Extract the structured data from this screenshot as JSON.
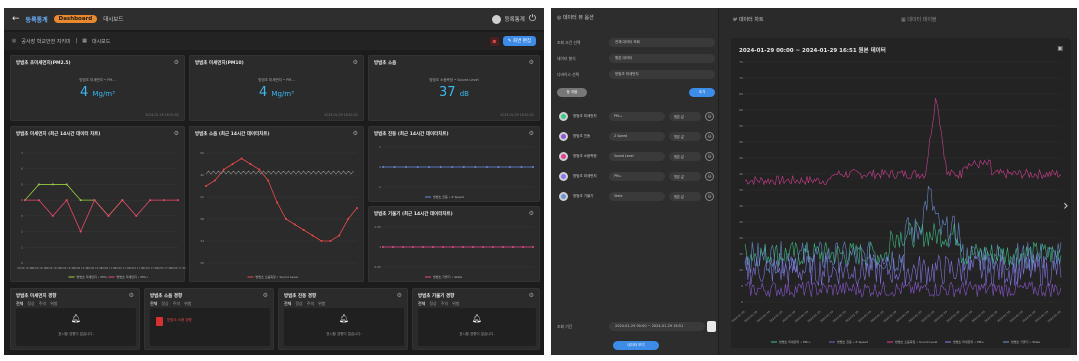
{
  "left": {
    "topbar": {
      "brand": "등록통계",
      "dashboard_pill": "Dashboard",
      "page": "대시보드",
      "user": "등록통계"
    },
    "crumb": {
      "path": "공사장 학교안전 지키미",
      "separator": "|",
      "page": "대시보드",
      "edit_button": "화면 편집"
    },
    "cards": {
      "pm10": {
        "title": "방범초 초미세먼지(PM2.5)",
        "sub": "방범초 미세먼지 • PM...",
        "value": "4",
        "unit": "Mg/m³",
        "stamp": "2024.01.29 16:51:52"
      },
      "pm25": {
        "title": "방범초 미세먼지(PM10)",
        "sub": "방범초 미세먼지 • PM...",
        "value": "4",
        "unit": "Mg/m³",
        "stamp": "2024.01.29 16:51:52"
      },
      "sound": {
        "title": "방범초 소음",
        "sub": "방범초 소음측정 • Sound Level",
        "value": "37",
        "unit": "dB",
        "stamp": "2024.01.29 16:51:52"
      },
      "dust_chart": {
        "title": "방범초 미세먼지 (최근 14시간 데이터 차트)",
        "legend1": "방범초 미세먼지 • PM₁₀",
        "legend2": "방범초 미세먼지 • PM₂.₅"
      },
      "sound_chart": {
        "title": "방범초 소음 (최근 14시간 데이터차트)",
        "legend1": "방범초 소음측정 • Sound Level"
      },
      "vib_chart": {
        "title": "방범초 진동 (최근 14시간 데이터차트)",
        "legend1": "방범초 진동 • Z Speed"
      },
      "tilt_chart": {
        "title": "방범초 기울기 (최근 14시간 데이터차트)",
        "legend1": "방범초 기울기 • State"
      },
      "alerts": [
        {
          "title": "방범초 미세먼지 경향",
          "tabs": [
            "전체",
            "정상",
            "주의",
            "위험"
          ],
          "msg": "표시할 경향이 없습니다."
        },
        {
          "title": "방범초 소음 경향",
          "tabs": [
            "전체",
            "정상",
            "주의",
            "위험"
          ],
          "item": "방범초 소음 경향",
          "msg": ""
        },
        {
          "title": "방범초 진동 경향",
          "tabs": [
            "전체",
            "정상",
            "주의",
            "위험"
          ],
          "msg": "표시할 경향이 없습니다."
        },
        {
          "title": "방범초 기울기 경향",
          "tabs": [
            "전체",
            "정상",
            "주의",
            "위험"
          ],
          "msg": "표시할 경향이 없습니다."
        }
      ]
    }
  },
  "right": {
    "panel": {
      "heading": "데이터 뷰 옵션",
      "rows": [
        {
          "label": "조회 조건 선택",
          "value": "전체 데이터 조회"
        },
        {
          "label": "데이터 형식",
          "value": "원본 데이터"
        },
        {
          "label": "디바이스 선택",
          "value": "방범초 미세먼지"
        }
      ],
      "add_button": "추가",
      "remove_button": "등 지움",
      "series": [
        {
          "name": "방범초 미세먼지",
          "metric": "PM₂.₅",
          "agg": "원본 값",
          "color": "#3ec98a"
        },
        {
          "name": "방범초 진동",
          "metric": "Z Speed",
          "agg": "원본 값",
          "color": "#8f5ad8"
        },
        {
          "name": "방범초 소음측정",
          "metric": "Sound Level",
          "agg": "원본 값",
          "color": "#e0409a"
        },
        {
          "name": "방범초 미세먼지",
          "metric": "PM₁₀",
          "agg": "원본 값",
          "color": "#8a7af0"
        },
        {
          "name": "방범초 기울기",
          "metric": "State",
          "agg": "원본 값",
          "color": "#6c94d8"
        }
      ],
      "period_label": "조회 기간",
      "period_value": "2024-01-29 00:00 ~ 2024-01-29 16:51",
      "submit": "데이터 보기"
    },
    "tabs": {
      "chart": "데이터 차트",
      "table": "데이터 테이블"
    },
    "chart": {
      "heading": "2024-01-29 00:00 ~ 2024-01-29 16:51 원본 데이터"
    }
  },
  "chart_data": [
    {
      "type": "line",
      "title": "방범초 미세먼지 (최근 14시간 데이터 차트)",
      "categories": [
        "03/08 16:00",
        "03/08 16:10",
        "03/08 16:20",
        "03/08 16:30",
        "03/08 16:40",
        "03/08 16:50",
        "03/08 17:00",
        "03/08 17:10",
        "03/08 17:20",
        "03/08 17:30",
        "03/08 17:40",
        "03/08 17:50"
      ],
      "series": [
        {
          "name": "방범초 미세먼지 • PM₁₀",
          "values": [
            4,
            5,
            5,
            5,
            4,
            4,
            3,
            4,
            null,
            null,
            null,
            null
          ]
        },
        {
          "name": "방범초 미세먼지 • PM₂.₅",
          "values": [
            4,
            4,
            3,
            4,
            2,
            4,
            3,
            4,
            3,
            4,
            4,
            4
          ]
        }
      ],
      "ylim": [
        0,
        7
      ]
    },
    {
      "type": "line",
      "title": "방범초 소음 (최근 14시간 데이터차트)",
      "series": [
        {
          "name": "방범초 소음측정 • Sound Level",
          "values": [
            44,
            45,
            47,
            48,
            49,
            48,
            47,
            45,
            41,
            38,
            37,
            36,
            35,
            34,
            34,
            35,
            38,
            40
          ]
        }
      ],
      "ylim": [
        30,
        50
      ]
    },
    {
      "type": "line",
      "title": "방범초 진동 (최근 14시간 데이터차트)",
      "series": [
        {
          "name": "방범초 진동 • Z Speed",
          "values": [
            0,
            0,
            0,
            0,
            0,
            0,
            0,
            0,
            0,
            0,
            0,
            0,
            0,
            0
          ]
        }
      ]
    },
    {
      "type": "line",
      "title": "방범초 기울기 (최근 14시간 데이터차트)",
      "series": [
        {
          "name": "방범초 기울기 • State",
          "values": [
            1,
            1,
            1,
            1,
            1,
            1,
            1,
            1,
            1,
            1,
            1,
            1,
            1,
            1,
            1,
            1
          ]
        }
      ],
      "ylim": [
        0.95,
        1.05
      ]
    },
    {
      "type": "line",
      "title": "2024-01-29 00:00 ~ 2024-01-29 16:51 원본 데이터",
      "ylim": [
        0,
        75
      ],
      "series": [
        {
          "name": "방범초 미세먼지 • PM₂.₅",
          "color": "#3ec98a"
        },
        {
          "name": "방범초 진동 • Z Speed",
          "color": "#8f5ad8"
        },
        {
          "name": "방범초 소음측정 • Sound Level",
          "color": "#e0409a"
        },
        {
          "name": "방범초 미세먼지 • PM₁₀",
          "color": "#8a7af0"
        },
        {
          "name": "방범초 기울기 • State",
          "color": "#6c94d8"
        }
      ]
    }
  ]
}
